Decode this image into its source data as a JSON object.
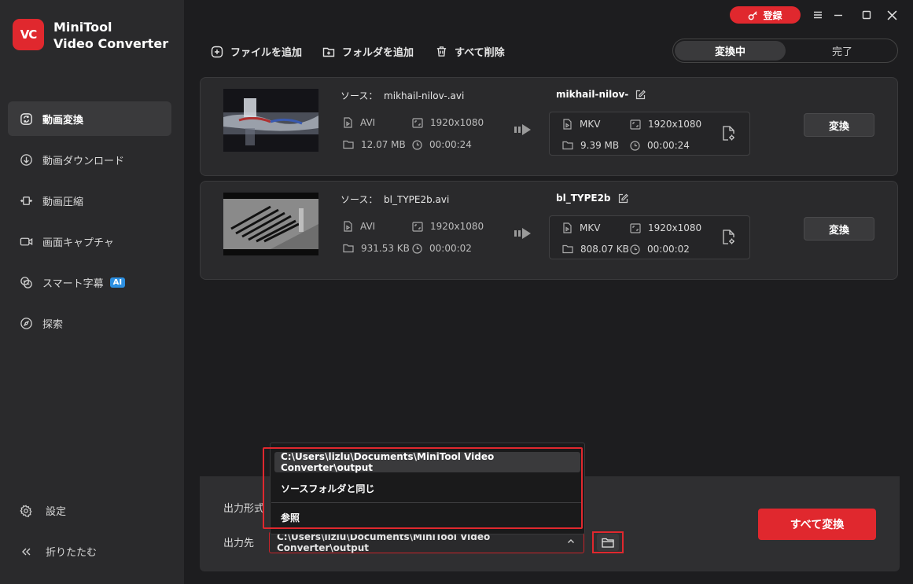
{
  "app": {
    "logo_text": "VC",
    "name_line1": "MiniTool",
    "name_line2": "Video Converter"
  },
  "titlebar": {
    "register_label": "登録"
  },
  "sidebar": {
    "items": [
      {
        "label": "動画変換",
        "icon": "convert-icon"
      },
      {
        "label": "動画ダウンロード",
        "icon": "download-icon"
      },
      {
        "label": "動画圧縮",
        "icon": "compress-icon"
      },
      {
        "label": "画面キャプチャ",
        "icon": "camera-icon"
      },
      {
        "label": "スマート字幕",
        "icon": "subtitle-icon",
        "badge": "AI"
      },
      {
        "label": "探索",
        "icon": "compass-icon"
      }
    ],
    "settings_label": "設定",
    "collapse_label": "折りたたむ"
  },
  "toolbar": {
    "add_file": "ファイルを追加",
    "add_folder": "フォルダを追加",
    "delete_all": "すべて削除",
    "tab_converting": "変換中",
    "tab_done": "完了"
  },
  "files": [
    {
      "source_prefix": "ソース：",
      "source_name": "mikhail-nilov-.avi",
      "src_format": "AVI",
      "src_resolution": "1920x1080",
      "src_size": "12.07 MB",
      "src_duration": "00:00:24",
      "out_name": "mikhail-nilov-",
      "out_format": "MKV",
      "out_resolution": "1920x1080",
      "out_size": "9.39 MB",
      "out_duration": "00:00:24",
      "convert_label": "変換"
    },
    {
      "source_prefix": "ソース：",
      "source_name": "bl_TYPE2b.avi",
      "src_format": "AVI",
      "src_resolution": "1920x1080",
      "src_size": "931.53 KB",
      "src_duration": "00:00:02",
      "out_name": "bl_TYPE2b",
      "out_format": "MKV",
      "out_resolution": "1920x1080",
      "out_size": "808.07 KB",
      "out_duration": "00:00:02",
      "convert_label": "変換"
    }
  ],
  "bottom": {
    "output_format_label": "出力形式",
    "output_dest_label": "出力先",
    "output_path": "C:\\Users\\lizlu\\Documents\\MiniTool Video Converter\\output",
    "convert_all_label": "すべて変換"
  },
  "dropdown": {
    "options": [
      "C:\\Users\\lizlu\\Documents\\MiniTool Video Converter\\output",
      "ソースフォルダと同じ",
      "参照"
    ]
  },
  "colors": {
    "accent": "#e0282e",
    "background": "#1d1d1f",
    "sidebar": "#2a2a2c",
    "ai_badge": "#2d8fe0"
  }
}
